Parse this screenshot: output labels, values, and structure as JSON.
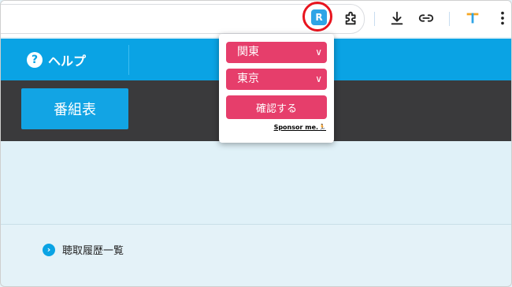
{
  "browser": {
    "extension_badge_letter": "R",
    "highlight_color": "#e8141e"
  },
  "site": {
    "help_label": "ヘルプ",
    "help_icon_glyph": "?",
    "schedule_button": "番組表",
    "history_icon_glyph": "›",
    "history_link": "聴取履歴一覧"
  },
  "popup": {
    "region_select": "関東",
    "area_select": "東京",
    "confirm_button": "確認する",
    "sponsor_link": "Sponsor me.",
    "sponsor_emoji": "🏃",
    "accent_color": "#e63e6b"
  },
  "colors": {
    "brand_blue": "#0aa3e4",
    "dark_bar": "#3a3a3c",
    "content_bg": "#e0f1f8"
  }
}
